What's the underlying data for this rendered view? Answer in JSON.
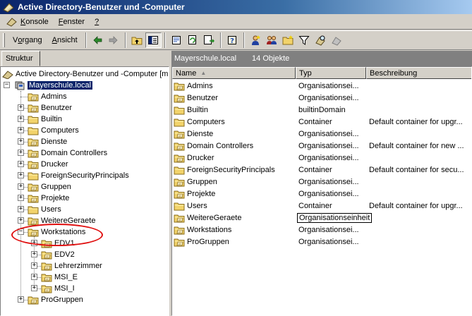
{
  "window": {
    "title": "Active Directory-Benutzer und -Computer"
  },
  "menu": {
    "items": [
      {
        "pre": "",
        "key": "K",
        "rest": "onsole",
        "icon": "console-icon"
      },
      {
        "pre": "",
        "key": "F",
        "rest": "enster",
        "icon": ""
      },
      {
        "pre": "",
        "key": "?",
        "rest": "",
        "icon": ""
      }
    ]
  },
  "toolbar": {
    "action": {
      "pre": "V",
      "key": "o",
      "rest": "rgang"
    },
    "view": {
      "pre": "",
      "key": "A",
      "rest": "nsicht"
    },
    "icons": [
      "back-arrow-icon",
      "forward-arrow-icon",
      "up-folder-icon",
      "show-tree-icon",
      "properties-icon",
      "refresh-icon",
      "export-list-icon",
      "help-icon",
      "new-user-icon",
      "new-group-icon",
      "new-ou-icon",
      "filter-icon",
      "find-icon",
      "delegate-icon"
    ]
  },
  "left_tab": "Struktur",
  "tree": {
    "root": "Active Directory-Benutzer und -Computer [m",
    "domain": "Mayerschule.local",
    "nodes": [
      {
        "label": "Admins",
        "kind": "ou",
        "expander": "",
        "level": 1
      },
      {
        "label": "Benutzer",
        "kind": "ou",
        "expander": "+",
        "level": 1
      },
      {
        "label": "Builtin",
        "kind": "folder",
        "expander": "+",
        "level": 1
      },
      {
        "label": "Computers",
        "kind": "folder",
        "expander": "+",
        "level": 1
      },
      {
        "label": "Dienste",
        "kind": "ou",
        "expander": "+",
        "level": 1
      },
      {
        "label": "Domain Controllers",
        "kind": "ou",
        "expander": "+",
        "level": 1
      },
      {
        "label": "Drucker",
        "kind": "ou",
        "expander": "+",
        "level": 1
      },
      {
        "label": "ForeignSecurityPrincipals",
        "kind": "folder",
        "expander": "+",
        "level": 1
      },
      {
        "label": "Gruppen",
        "kind": "ou",
        "expander": "+",
        "level": 1
      },
      {
        "label": "Projekte",
        "kind": "ou",
        "expander": "+",
        "level": 1
      },
      {
        "label": "Users",
        "kind": "folder",
        "expander": "+",
        "level": 1
      },
      {
        "label": "WeitereGeraete",
        "kind": "ou",
        "expander": "+",
        "level": 1
      },
      {
        "label": "Workstations",
        "kind": "ou",
        "expander": "-",
        "level": 1
      },
      {
        "label": "EDV1",
        "kind": "ou",
        "expander": "+",
        "level": 2
      },
      {
        "label": "EDV2",
        "kind": "ou",
        "expander": "+",
        "level": 2
      },
      {
        "label": "Lehrerzimmer",
        "kind": "ou",
        "expander": "+",
        "level": 2
      },
      {
        "label": "MSI_E",
        "kind": "ou",
        "expander": "+",
        "level": 2
      },
      {
        "label": "MSI_I",
        "kind": "ou",
        "expander": "+",
        "level": 2
      },
      {
        "label": "ProGruppen",
        "kind": "ou",
        "expander": "+",
        "level": 1
      }
    ]
  },
  "right_header": {
    "location": "Mayerschule.local",
    "count": "14 Objekte"
  },
  "list": {
    "columns": [
      {
        "label": "Name",
        "sort": "▲",
        "width": 175
      },
      {
        "label": "Typ",
        "sort": "",
        "width": 100
      },
      {
        "label": "Beschreibung",
        "sort": "",
        "width": 151
      }
    ],
    "rows": [
      {
        "name": "Admins",
        "kind": "ou",
        "type": "Organisationsei...",
        "desc": ""
      },
      {
        "name": "Benutzer",
        "kind": "ou",
        "type": "Organisationsei...",
        "desc": ""
      },
      {
        "name": "Builtin",
        "kind": "folder",
        "type": "builtinDomain",
        "desc": ""
      },
      {
        "name": "Computers",
        "kind": "folder",
        "type": "Container",
        "desc": "Default container for upgr..."
      },
      {
        "name": "Dienste",
        "kind": "ou",
        "type": "Organisationsei...",
        "desc": ""
      },
      {
        "name": "Domain Controllers",
        "kind": "ou",
        "type": "Organisationsei...",
        "desc": "Default container for new ..."
      },
      {
        "name": "Drucker",
        "kind": "ou",
        "type": "Organisationsei...",
        "desc": ""
      },
      {
        "name": "ForeignSecurityPrincipals",
        "kind": "folder",
        "type": "Container",
        "desc": "Default container for secu..."
      },
      {
        "name": "Gruppen",
        "kind": "ou",
        "type": "Organisationsei...",
        "desc": ""
      },
      {
        "name": "Projekte",
        "kind": "ou",
        "type": "Organisationsei...",
        "desc": ""
      },
      {
        "name": "Users",
        "kind": "folder",
        "type": "Container",
        "desc": "Default container for upgr..."
      },
      {
        "name": "WeitereGeraete",
        "kind": "ou",
        "type": "Organisationseinheit",
        "desc": "",
        "focused": true
      },
      {
        "name": "Workstations",
        "kind": "ou",
        "type": "Organisationsei...",
        "desc": ""
      },
      {
        "name": "ProGruppen",
        "kind": "ou",
        "type": "Organisationsei...",
        "desc": ""
      }
    ]
  },
  "colors": {
    "accent": "#0a246a",
    "annotation": "#e01010",
    "folder": "#f2d36b"
  }
}
